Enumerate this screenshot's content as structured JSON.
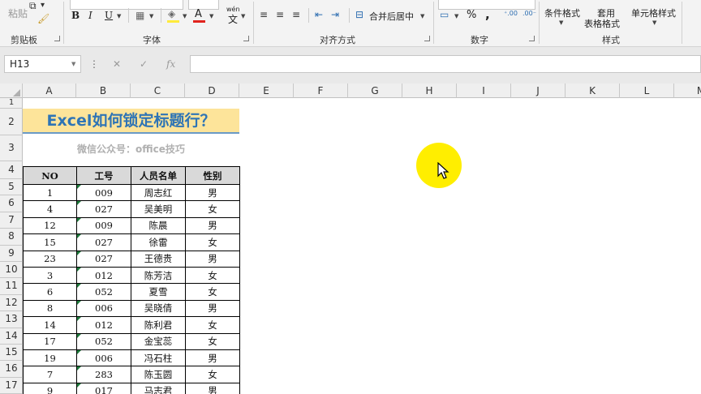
{
  "ribbon": {
    "paste_label": "粘贴",
    "groups": {
      "clipboard": "剪贴板",
      "font": "字体",
      "alignment": "对齐方式",
      "number": "数字",
      "styles": "样式"
    },
    "font_buttons": [
      "B",
      "I",
      "U"
    ],
    "font_color_glyph": "A",
    "wen_glyph": "wén",
    "merge_label": "合并后居中",
    "percent_glyph": "%",
    "comma_glyph": ",",
    "conditional_format_label": "条件格式",
    "table_format_label_1": "套用",
    "table_format_label_2": "表格格式",
    "cell_styles_label": "单元格样式"
  },
  "formula_bar": {
    "name_box": "H13",
    "more_glyph": "⋮",
    "cancel_glyph": "✕",
    "enter_glyph": "✓",
    "fx_glyph": "fx",
    "formula": ""
  },
  "columns": [
    "A",
    "B",
    "C",
    "D",
    "E",
    "F",
    "G",
    "H",
    "I",
    "J",
    "K",
    "L",
    "M"
  ],
  "rows": [
    "1",
    "2",
    "3",
    "4",
    "5",
    "6",
    "7",
    "8",
    "9",
    "10",
    "11",
    "12",
    "13",
    "14",
    "15",
    "16",
    "17"
  ],
  "sheet": {
    "title": "Excel如何锁定标题行？",
    "subtitle": "微信公众号：office技巧",
    "headers": [
      "NO",
      "工号",
      "人员名单",
      "性别"
    ],
    "records": [
      [
        "1",
        "009",
        "周志红",
        "男"
      ],
      [
        "4",
        "027",
        "吴美明",
        "女"
      ],
      [
        "12",
        "009",
        "陈晨",
        "男"
      ],
      [
        "15",
        "027",
        "徐雷",
        "女"
      ],
      [
        "23",
        "027",
        "王德贵",
        "男"
      ],
      [
        "3",
        "012",
        "陈芳洁",
        "女"
      ],
      [
        "6",
        "052",
        "夏雪",
        "女"
      ],
      [
        "8",
        "006",
        "吴晓倩",
        "男"
      ],
      [
        "14",
        "012",
        "陈利君",
        "女"
      ],
      [
        "17",
        "052",
        "金宝蕊",
        "女"
      ],
      [
        "19",
        "006",
        "冯石柱",
        "男"
      ],
      [
        "7",
        "283",
        "陈玉圆",
        "女"
      ],
      [
        "9",
        "017",
        "马志君",
        "男"
      ]
    ]
  },
  "colors": {
    "title_fill": "#fde49a",
    "title_text": "#2e74b5",
    "header_fill": "#d9d9d9",
    "highlight": "#ffee00",
    "error_triangle": "#1e7b3c"
  }
}
